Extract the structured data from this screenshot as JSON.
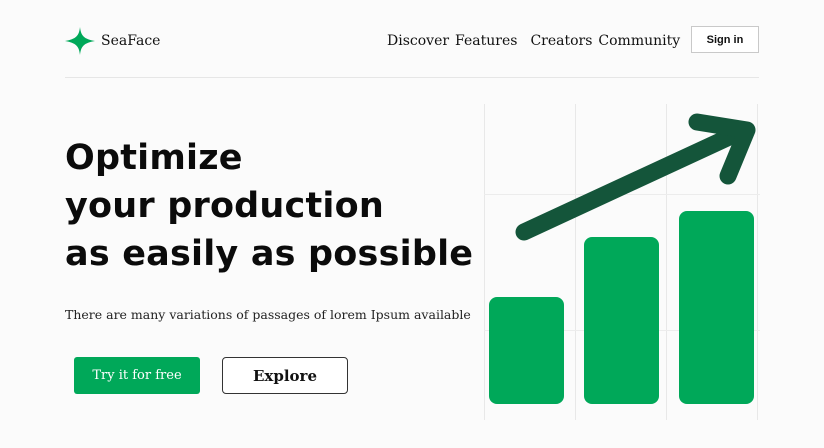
{
  "header": {
    "brand": "SeaFace",
    "nav": [
      "Discover",
      "Features",
      "Creators",
      "Community"
    ],
    "sign_in_label": "Sign in"
  },
  "hero": {
    "headline_lines": [
      "Optimize",
      "your production",
      "as easily as possible"
    ],
    "subtext": "There are many variations of passages of lorem Ipsum available",
    "primary_cta": "Try it for free",
    "secondary_cta": "Explore"
  },
  "illustration": {
    "bar_levels": [
      0.34,
      0.53,
      0.61
    ],
    "bar_color": "#00a859",
    "arrow_color": "#14553a",
    "icons": [
      "upward-trend-arrow-icon"
    ]
  },
  "colors": {
    "accent": "#00a859",
    "logo": "#00a859",
    "text": "#111111"
  }
}
